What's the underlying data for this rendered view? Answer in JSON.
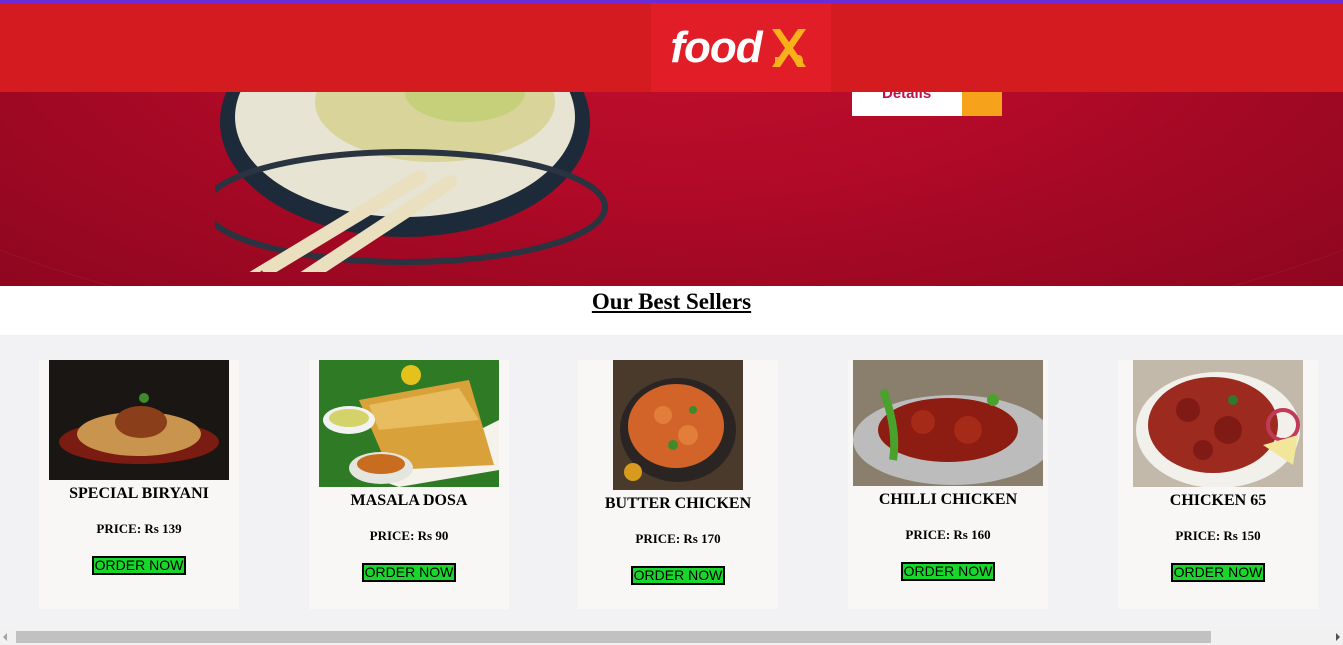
{
  "header": {
    "logo_text": "food"
  },
  "banner": {
    "details_label": "Details"
  },
  "section": {
    "title": "Our Best Sellers"
  },
  "products": [
    {
      "name": "SPECIAL BIRYANI",
      "price": "PRICE: Rs 139",
      "button": "ORDER NOW",
      "image": "biryani"
    },
    {
      "name": "MASALA DOSA",
      "price": "PRICE: Rs 90",
      "button": "ORDER NOW",
      "image": "dosa"
    },
    {
      "name": "BUTTER CHICKEN",
      "price": "PRICE: Rs 170",
      "button": "ORDER NOW",
      "image": "butter-chicken"
    },
    {
      "name": "CHILLI CHICKEN",
      "price": "PRICE: Rs 160",
      "button": "ORDER NOW",
      "image": "chilli-chicken"
    },
    {
      "name": "CHICKEN 65",
      "price": "PRICE: Rs 150",
      "button": "ORDER NOW",
      "image": "chicken-65"
    }
  ],
  "colors": {
    "header": "#d41b1f",
    "banner": "#b10a28",
    "button": "#19d62a"
  }
}
